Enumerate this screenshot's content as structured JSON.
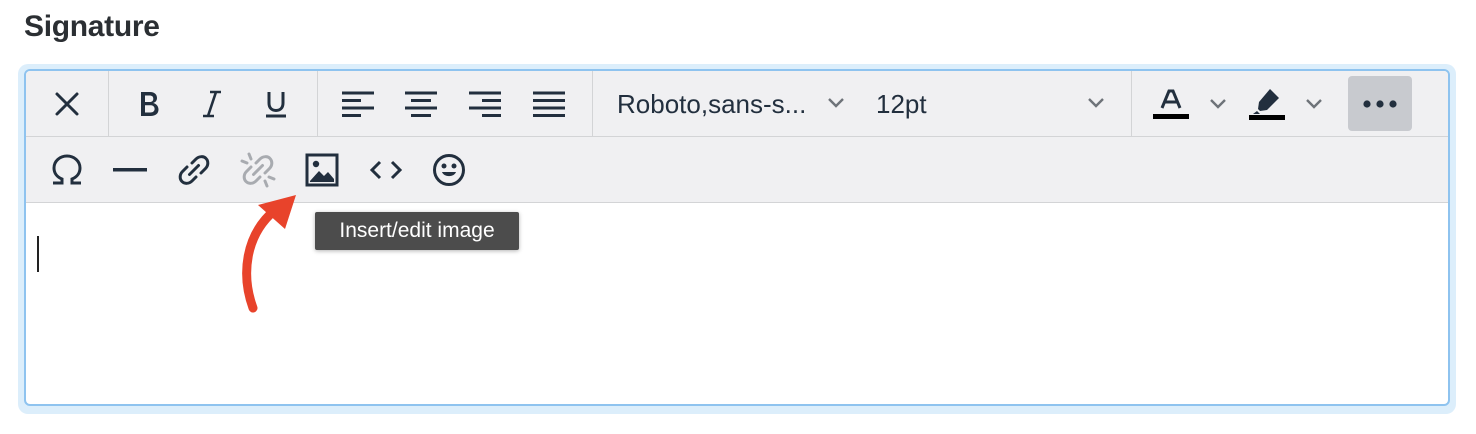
{
  "section": {
    "title": "Signature"
  },
  "toolbar": {
    "font_family": "Roboto,sans-s...",
    "font_size": "12pt",
    "buttons_row1": [
      {
        "name": "remove-format-button",
        "icon": "close-icon"
      },
      {
        "name": "bold-button",
        "icon": "bold-icon"
      },
      {
        "name": "italic-button",
        "icon": "italic-icon"
      },
      {
        "name": "underline-button",
        "icon": "underline-icon"
      },
      {
        "name": "align-left-button",
        "icon": "align-left-icon"
      },
      {
        "name": "align-center-button",
        "icon": "align-center-icon"
      },
      {
        "name": "align-right-button",
        "icon": "align-right-icon"
      },
      {
        "name": "align-justify-button",
        "icon": "align-justify-icon"
      },
      {
        "name": "text-color-button",
        "icon": "text-color-icon"
      },
      {
        "name": "highlight-color-button",
        "icon": "highlighter-icon"
      },
      {
        "name": "more-button",
        "icon": "more-icon"
      }
    ],
    "buttons_row2": [
      {
        "name": "special-character-button",
        "icon": "omega-icon"
      },
      {
        "name": "horizontal-line-button",
        "icon": "horizontal-line-icon"
      },
      {
        "name": "link-button",
        "icon": "link-icon"
      },
      {
        "name": "unlink-button",
        "icon": "unlink-icon",
        "disabled": true
      },
      {
        "name": "insert-image-button",
        "icon": "image-icon"
      },
      {
        "name": "source-code-button",
        "icon": "code-icon"
      },
      {
        "name": "emoticons-button",
        "icon": "smiley-icon"
      }
    ],
    "text_color": "#000000",
    "highlight_color": "#000000"
  },
  "tooltip": {
    "text": "Insert/edit image"
  },
  "annotation": {
    "arrow_color": "#e8432b"
  }
}
